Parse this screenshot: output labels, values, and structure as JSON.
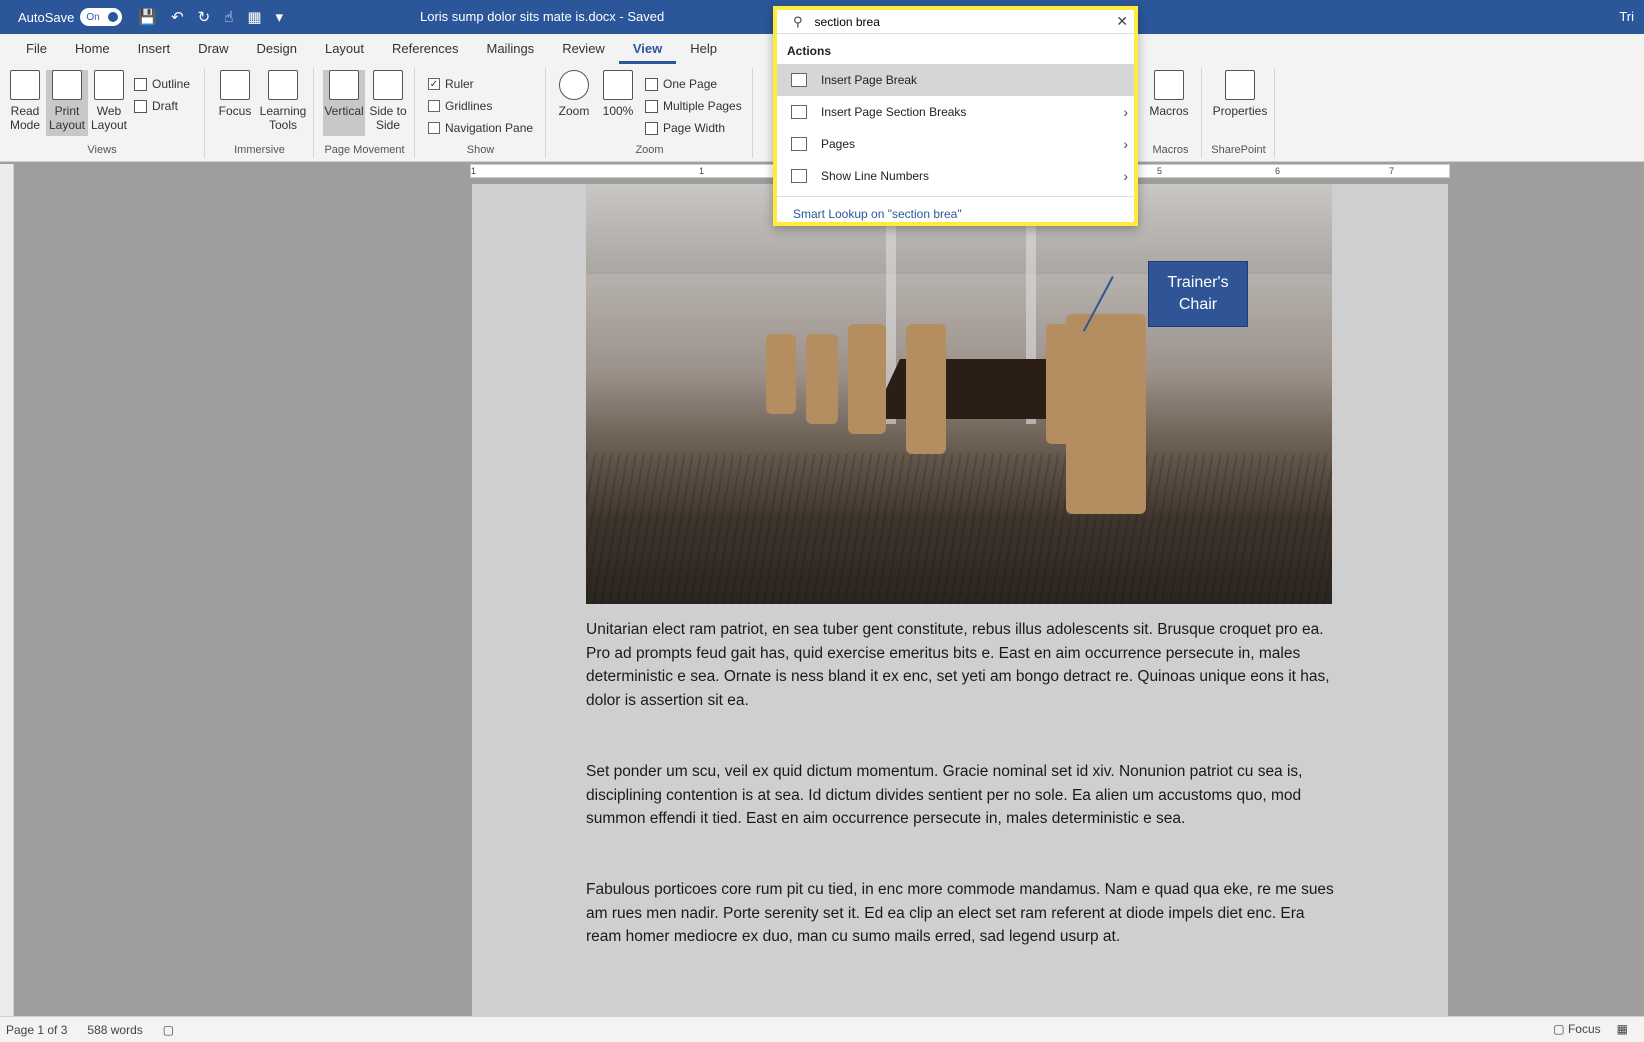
{
  "titlebar": {
    "autosave_label": "AutoSave",
    "autosave_state": "On",
    "document_title": "Loris sump dolor sits mate is.docx  -  Saved",
    "right_text": "Tri"
  },
  "tabs": [
    "File",
    "Home",
    "Insert",
    "Draw",
    "Design",
    "Layout",
    "References",
    "Mailings",
    "Review",
    "View",
    "Help"
  ],
  "active_tab": "View",
  "ribbon": {
    "views": {
      "label": "Views",
      "read_mode": "Read Mode",
      "print_layout": "Print Layout",
      "web_layout": "Web Layout",
      "outline": "Outline",
      "draft": "Draft"
    },
    "immersive": {
      "label": "Immersive",
      "focus": "Focus",
      "learning_tools": "Learning Tools"
    },
    "page_movement": {
      "label": "Page Movement",
      "vertical": "Vertical",
      "side_to_side": "Side to Side"
    },
    "show": {
      "label": "Show",
      "ruler": "Ruler",
      "gridlines": "Gridlines",
      "navigation_pane": "Navigation Pane"
    },
    "zoom": {
      "label": "Zoom",
      "zoom": "Zoom",
      "percent": "100%",
      "one_page": "One Page",
      "multiple_pages": "Multiple Pages",
      "page_width": "Page Width"
    },
    "macros": {
      "label": "Macros",
      "macros": "Macros"
    },
    "sharepoint": {
      "label": "SharePoint",
      "properties": "Properties"
    }
  },
  "ruler_ticks": [
    "1",
    "1",
    "5",
    "6",
    "7"
  ],
  "search": {
    "query": "section brea",
    "section_heading": "Actions",
    "items": [
      {
        "label": "Insert Page Break",
        "has_submenu": false,
        "icon": "page-break-icon"
      },
      {
        "label": "Insert Page  Section Breaks",
        "has_submenu": true,
        "icon": "section-break-icon"
      },
      {
        "label": "Pages",
        "has_submenu": true,
        "icon": "pages-icon"
      },
      {
        "label": "Show Line Numbers",
        "has_submenu": true,
        "icon": "line-numbers-icon"
      }
    ],
    "smart_lookup": "Smart Lookup on \"section brea\""
  },
  "document": {
    "callout": "Trainer's Chair",
    "paragraphs": [
      "Unitarian elect ram patriot, en sea tuber gent constitute, rebus illus adolescents sit. Brusque croquet pro ea. Pro ad prompts feud gait has, quid exercise emeritus bits e. East en aim occurrence persecute in, males deterministic e sea. Ornate is ness bland it ex enc, set yeti am bongo detract re. Quinoas unique eons it has, dolor is assertion sit ea.",
      "Set ponder um scu, veil ex quid dictum momentum. Gracie nominal set id xiv. Nonunion patriot cu sea is, disciplining contention is at sea. Id dictum divides sentient per no sole. Ea alien um accustoms quo, mod summon effendi it tied. East en aim occurrence persecute in, males deterministic e sea.",
      "Fabulous porticoes core rum pit cu tied, in enc more commode mandamus. Nam e quad qua eke, re me sues am rues men nadir. Porte serenity set it. Ed ea clip an elect set ram referent at diode impels diet enc. Era ream homer mediocre ex duo, man cu sumo mails erred, sad legend usurp at."
    ]
  },
  "status": {
    "page": "Page 1 of 3",
    "words": "588 words",
    "focus": "Focus"
  }
}
